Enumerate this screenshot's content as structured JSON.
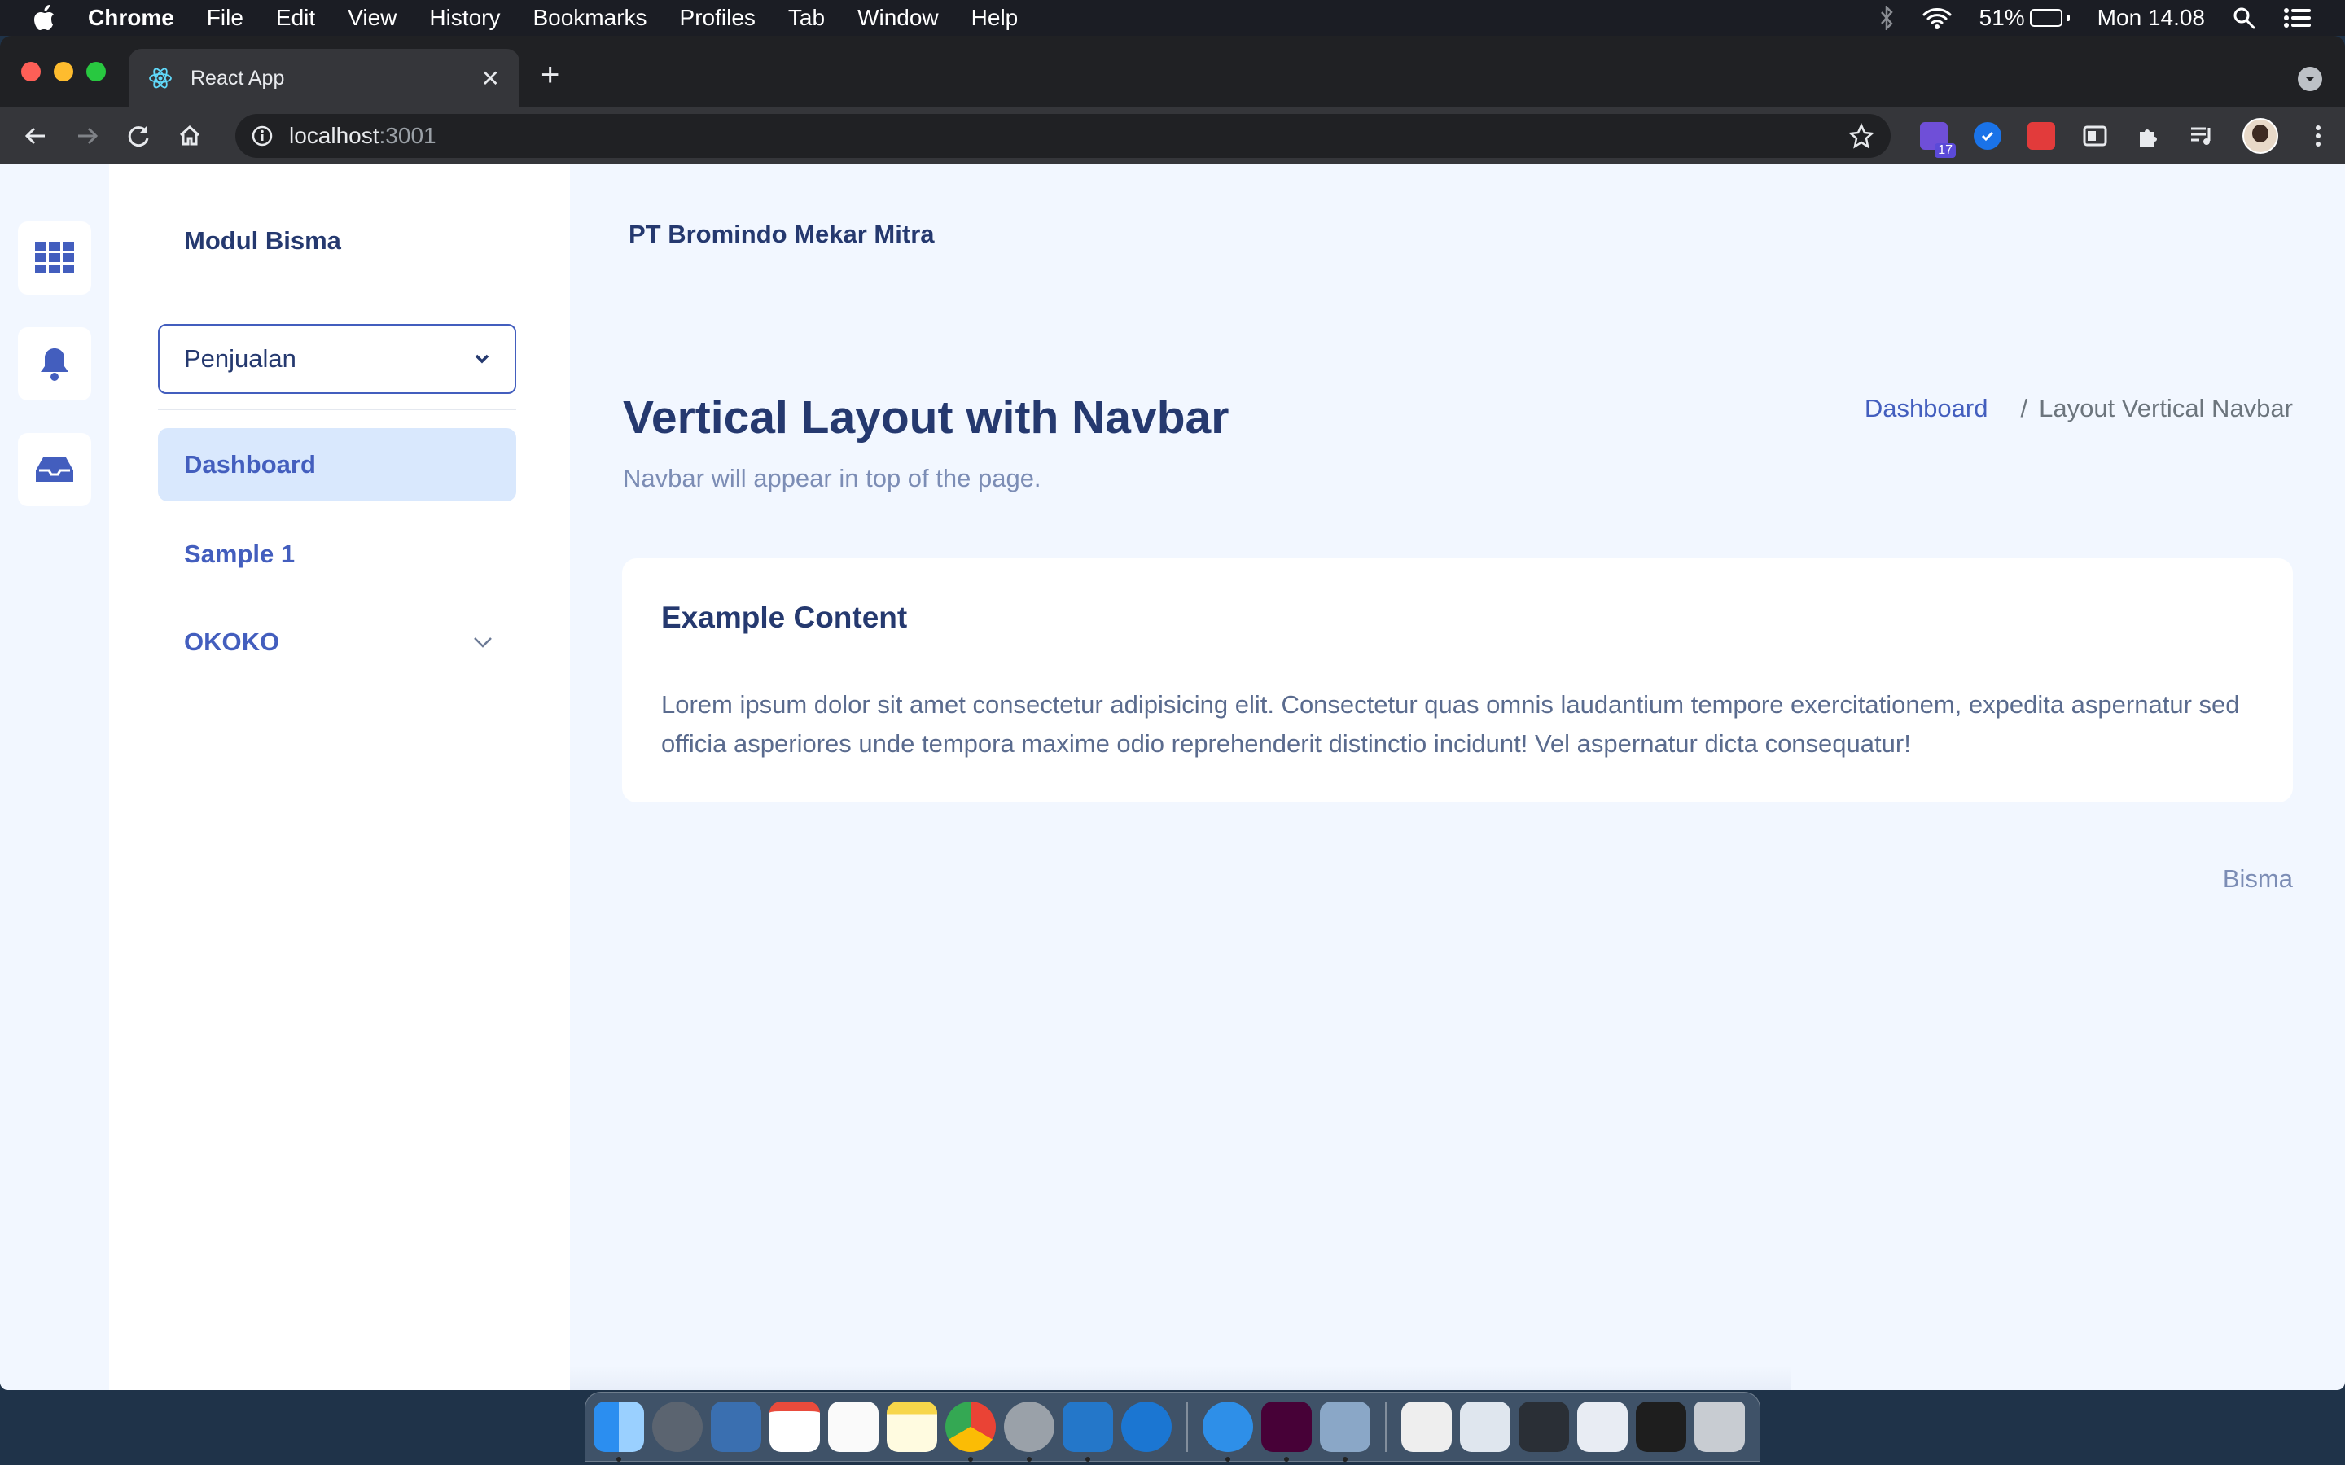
{
  "menubar": {
    "app_name": "Chrome",
    "items": [
      "File",
      "Edit",
      "View",
      "History",
      "Bookmarks",
      "Profiles",
      "Tab",
      "Window",
      "Help"
    ],
    "battery_percent": "51%",
    "battery_level": 0.51,
    "clock": "Mon 14.08"
  },
  "browser": {
    "tab_title": "React App",
    "url_host": "localhost",
    "url_port": ":3001",
    "extension_badge": "17"
  },
  "icon_rail": {
    "icons": [
      "grid-icon",
      "bell-icon",
      "inbox-icon"
    ]
  },
  "sidebar": {
    "brand": "Modul Bisma",
    "select_value": "Penjualan",
    "items": [
      {
        "label": "Dashboard",
        "active": true
      },
      {
        "label": "Sample 1",
        "active": false
      },
      {
        "label": "OKOKO",
        "active": false,
        "has_submenu": true
      }
    ]
  },
  "main": {
    "navbar_title": "PT Bromindo Mekar Mitra",
    "page_title": "Vertical Layout with Navbar",
    "page_subtitle": "Navbar will appear in top of the page.",
    "breadcrumb": {
      "link": "Dashboard",
      "separator": "/",
      "current": "Layout Vertical Navbar"
    },
    "card": {
      "title": "Example Content",
      "body": "Lorem ipsum dolor sit amet consectetur adipisicing elit. Consectetur quas omnis laudantium tempore exercitationem, expedita aspernatur sed officia asperiores unde tempora maxime odio reprehenderit distinctio incidunt! Vel aspernatur dicta consequatur!"
    },
    "footer": "Bisma"
  },
  "colors": {
    "primary": "#435ebe",
    "heading": "#25396f",
    "muted": "#7c8db5",
    "page_bg": "#f2f7ff",
    "active_item_bg": "#d9e8fd"
  }
}
